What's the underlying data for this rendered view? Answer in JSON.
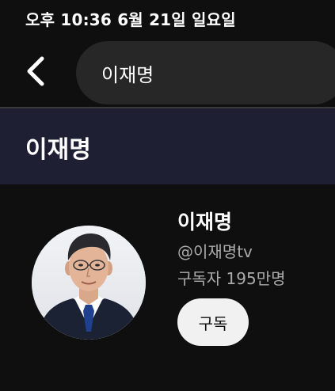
{
  "status_bar": {
    "text": "오후 10:36   6월 21일 일요일"
  },
  "top_bar": {
    "back_icon": "chevron-left-icon",
    "search_query": "이재명"
  },
  "channel_header": {
    "title": "이재명",
    "background_color": "#1f1f33"
  },
  "channel_card": {
    "name": "이재명",
    "handle": "@이재명tv",
    "subscribers": "구독자 195만명",
    "subscribe_label": "구독",
    "avatar_icon": "person-portrait-avatar"
  }
}
